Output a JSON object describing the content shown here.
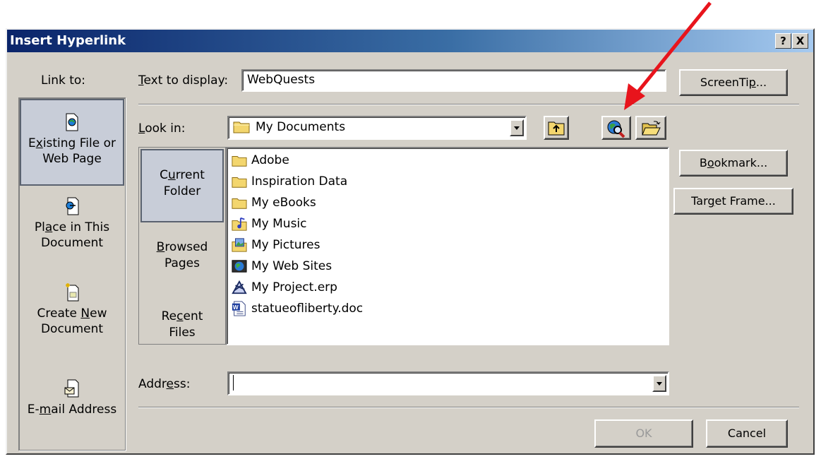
{
  "window": {
    "title": "Insert Hyperlink",
    "help_btn": "?",
    "close_btn": "X"
  },
  "link_to": {
    "label": "Link to:",
    "items": [
      {
        "label_before": "E",
        "label_u": "x",
        "label_after": "isting File or",
        "label2": "Web Page",
        "icon": "existing-file-icon",
        "selected": true
      },
      {
        "label_before": "Pl",
        "label_u": "a",
        "label_after": "ce in This",
        "label2": "Document",
        "icon": "place-in-document-icon"
      },
      {
        "label_before": "Create ",
        "label_u": "N",
        "label_after": "ew",
        "label2": "Document",
        "icon": "new-document-icon"
      },
      {
        "label_before": "E-",
        "label_u": "m",
        "label_after": "ail Address",
        "icon": "email-address-icon"
      }
    ]
  },
  "text_to_display": {
    "label_u": "T",
    "label_rest": "ext to display:",
    "value": "WebQuests"
  },
  "screentip_button": {
    "before": "ScreenTi",
    "u": "p",
    "after": "..."
  },
  "look_in": {
    "label_u": "L",
    "label_rest": "ook in:",
    "value": "My Documents"
  },
  "sidebar": {
    "current_folder": {
      "l1_before": "C",
      "l1_u": "u",
      "l1_after": "rrent",
      "l2": "Folder"
    },
    "browsed_pages": {
      "l1_u": "B",
      "l1_after": "rowsed",
      "l2": "Pages"
    },
    "recent_files": {
      "l1_before": "Re",
      "l1_u": "c",
      "l1_after": "ent",
      "l2": "Files"
    }
  },
  "files": [
    {
      "name": "Adobe",
      "icon": "folder-icon"
    },
    {
      "name": "Inspiration Data",
      "icon": "folder-icon"
    },
    {
      "name": "My eBooks",
      "icon": "folder-icon"
    },
    {
      "name": "My Music",
      "icon": "music-folder-icon"
    },
    {
      "name": "My Pictures",
      "icon": "pictures-folder-icon"
    },
    {
      "name": "My Web Sites",
      "icon": "web-sites-folder-icon"
    },
    {
      "name": "My Project.erp",
      "icon": "erp-file-icon"
    },
    {
      "name": "statueofliberty.doc",
      "icon": "word-doc-icon"
    }
  ],
  "right_buttons": {
    "bookmark": {
      "before": "B",
      "u": "o",
      "after": "okmark..."
    },
    "target_frame": {
      "before": "Tar",
      "u": "g",
      "after": "et Frame..."
    }
  },
  "address": {
    "label_before": "Addr",
    "label_u": "e",
    "label_after": "ss:",
    "value": ""
  },
  "ok_label": "OK",
  "cancel_label": "Cancel",
  "colors": {
    "titlebar_start": "#0a246a",
    "titlebar_end": "#a6caf0",
    "dialog_bg": "#d4d0c8",
    "arrow": "#e8141c"
  }
}
